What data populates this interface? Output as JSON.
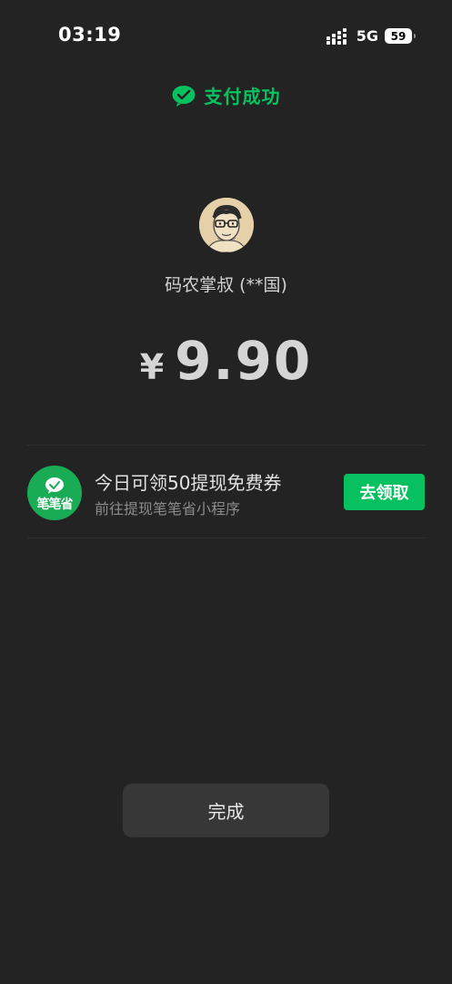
{
  "status_bar": {
    "time": "03:19",
    "network": "5G",
    "battery": "59"
  },
  "header": {
    "success_text": "支付成功"
  },
  "payment": {
    "payee": "码农掌叔 (**国)",
    "currency_symbol": "¥",
    "amount": "9.90"
  },
  "promo": {
    "logo_text": "笔笔省",
    "title": "今日可领50提现免费券",
    "subtitle": "前往提现笔笔省小程序",
    "button_label": "去领取"
  },
  "footer": {
    "done_label": "完成"
  },
  "colors": {
    "accent": "#07c160",
    "background": "#232323",
    "button_bg": "#373737"
  }
}
